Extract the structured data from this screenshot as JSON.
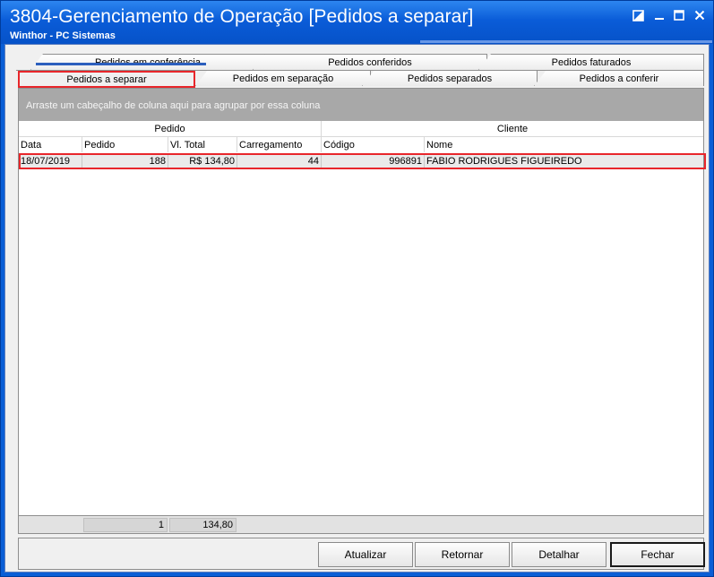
{
  "window": {
    "title": "3804-Gerenciamento de Operação [Pedidos a separar]",
    "subtitle": "Winthor - PC Sistemas",
    "controls": [
      "restore-icon",
      "minimize-icon",
      "maximize-icon",
      "close-icon"
    ]
  },
  "tabs": {
    "back_row": [
      "Pedidos em conferência",
      "Pedidos conferidos",
      "Pedidos faturados"
    ],
    "front_row": [
      "Pedidos a separar",
      "Pedidos em separação",
      "Pedidos separados",
      "Pedidos a conferir"
    ],
    "active": "Pedidos a separar"
  },
  "grid": {
    "group_hint": "Arraste um cabeçalho de coluna aqui para agrupar por essa coluna",
    "bands": [
      "Pedido",
      "Cliente"
    ],
    "columns": [
      "Data",
      "Pedido",
      "Vl. Total",
      "Carregamento",
      "Código",
      "Nome"
    ],
    "rows": [
      [
        "18/07/2019",
        "188",
        "R$ 134,80",
        "44",
        "996891",
        "FABIO RODRIGUES FIGUEIREDO"
      ]
    ],
    "footer": {
      "count": "1",
      "total": "134,80"
    }
  },
  "buttons": {
    "atualizar": "Atualizar",
    "retornar": "Retornar",
    "detalhar": "Detalhar",
    "fechar": "Fechar"
  },
  "colors": {
    "titlebar": "#0a5cd8",
    "highlight": "#e8262b",
    "group_bar": "#a8a8a8"
  }
}
